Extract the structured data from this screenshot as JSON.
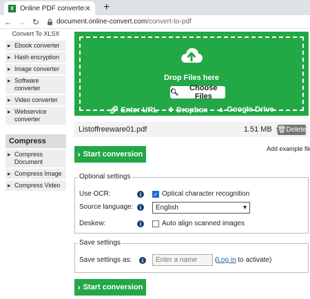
{
  "browser": {
    "tab_title": "Online PDF converter",
    "tab_favicon": "X",
    "close": "✕",
    "new_tab": "+",
    "url_domain": "document.online-convert.com",
    "url_path": "/convert-to-pdf"
  },
  "sidebar": {
    "heading": "Convert To XLSX",
    "items": [
      "Ebook converter",
      "Hash encryption",
      "Image converter",
      "Software converter",
      "Video converter",
      "Webservice converter"
    ],
    "section": "Compress",
    "compress_items": [
      "Compress Document",
      "Compress Image",
      "Compress Video"
    ]
  },
  "dropzone": {
    "drop_text": "Drop Files here",
    "choose_label": "Choose Files",
    "enter_url": "Enter URL",
    "dropbox": "Dropbox",
    "google_drive": "Google Drive"
  },
  "file": {
    "name": "Listoffreeware01.pdf",
    "size": "1.51 MB",
    "delete_label": "Delete"
  },
  "add_example": "Add example file",
  "start_label": "Start conversion",
  "optional": {
    "legend": "Optional settings",
    "ocr_label": "Use OCR:",
    "ocr_option": "Optical character recognition",
    "ocr_checked": true,
    "source_label": "Source language:",
    "source_value": "English",
    "deskew_label": "Deskew:",
    "deskew_option": "Auto align scanned images",
    "deskew_checked": false
  },
  "save": {
    "legend": "Save settings",
    "label": "Save settings as:",
    "placeholder": "Enter a name",
    "login_pre": "(",
    "login_link": "Log in",
    "login_post": " to activate)"
  },
  "colors": {
    "green": "#22a845",
    "info_blue": "#1a3f73"
  }
}
